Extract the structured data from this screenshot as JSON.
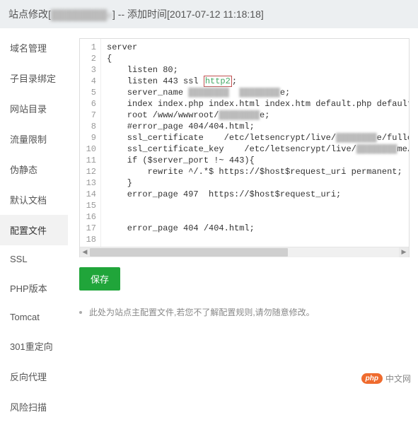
{
  "header": {
    "prefix": "站点修改[",
    "domain_masked": "████████e",
    "suffix": "] -- 添加时间[2017-07-12 11:18:18]"
  },
  "sidebar": {
    "items": [
      {
        "label": "域名管理"
      },
      {
        "label": "子目录绑定"
      },
      {
        "label": "网站目录"
      },
      {
        "label": "流量限制"
      },
      {
        "label": "伪静态"
      },
      {
        "label": "默认文档"
      },
      {
        "label": "配置文件",
        "active": true
      },
      {
        "label": "SSL"
      },
      {
        "label": "PHP版本"
      },
      {
        "label": "Tomcat"
      },
      {
        "label": "301重定向"
      },
      {
        "label": "反向代理"
      },
      {
        "label": "风险扫描"
      }
    ]
  },
  "editor": {
    "lines": [
      "server",
      "{",
      "    listen 80;",
      "    listen 443 ssl |http2|;",
      "    server_name ████████  ████████e;",
      "    index index.php index.html index.htm default.php default.htm default.html;",
      "    root /www/wwwroot/████████e;",
      "    #error_page 404/404.html;",
      "    ssl_certificate    /etc/letsencrypt/live/████████e/fullchain.pem;",
      "    ssl_certificate_key    /etc/letsencrypt/live/████████me/privkey.pem;",
      "    if ($server_port !~ 443){",
      "        rewrite ^/.*$ https://$host$request_uri permanent;",
      "    }",
      "    error_page 497  https://$host$request_uri;",
      "",
      "",
      "    error_page 404 /404.html;"
    ],
    "line_start": 1,
    "line_end": 18
  },
  "actions": {
    "save_label": "保存"
  },
  "hint": {
    "text": "此处为站点主配置文件,若您不了解配置规则,请勿随意修改。"
  },
  "watermark": {
    "badge": "php",
    "text": "中文网"
  }
}
